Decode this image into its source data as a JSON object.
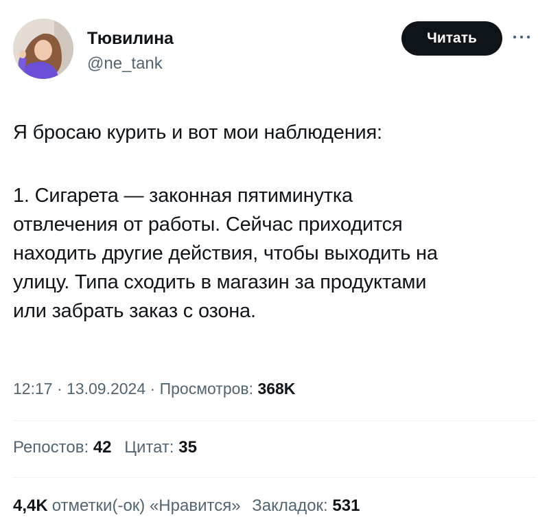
{
  "author": {
    "display_name": "Тювилина",
    "handle": "@ne_tank"
  },
  "header": {
    "follow_label": "Читать",
    "more_icon": "more-dots-icon"
  },
  "tweet": {
    "intro": "Я бросаю курить и вот мои наблюдения:",
    "lines": [
      "1. Сигарета — законная пятиминутка",
      "отвлечения от работы. Сейчас приходится",
      "находить другие действия, чтобы выходить на",
      "улицу. Типа сходить в магазин за продуктами",
      "или забрать заказ с озона."
    ]
  },
  "meta": {
    "time": "12:17",
    "separator": " · ",
    "date": "13.09.2024",
    "views_label": "Просмотров:",
    "views_value": "368K"
  },
  "stats": {
    "reposts_label": "Репостов:",
    "reposts_value": "42",
    "quotes_label": "Цитат:",
    "quotes_value": "35",
    "likes_value": "4,4K",
    "likes_label": "отметки(-ок) «Нравится»",
    "bookmarks_label": "Закладок:",
    "bookmarks_value": "531"
  },
  "colors": {
    "text": "#0f1419",
    "secondary": "#536471",
    "button_bg": "#0f1419",
    "divider": "#eff3f4"
  }
}
